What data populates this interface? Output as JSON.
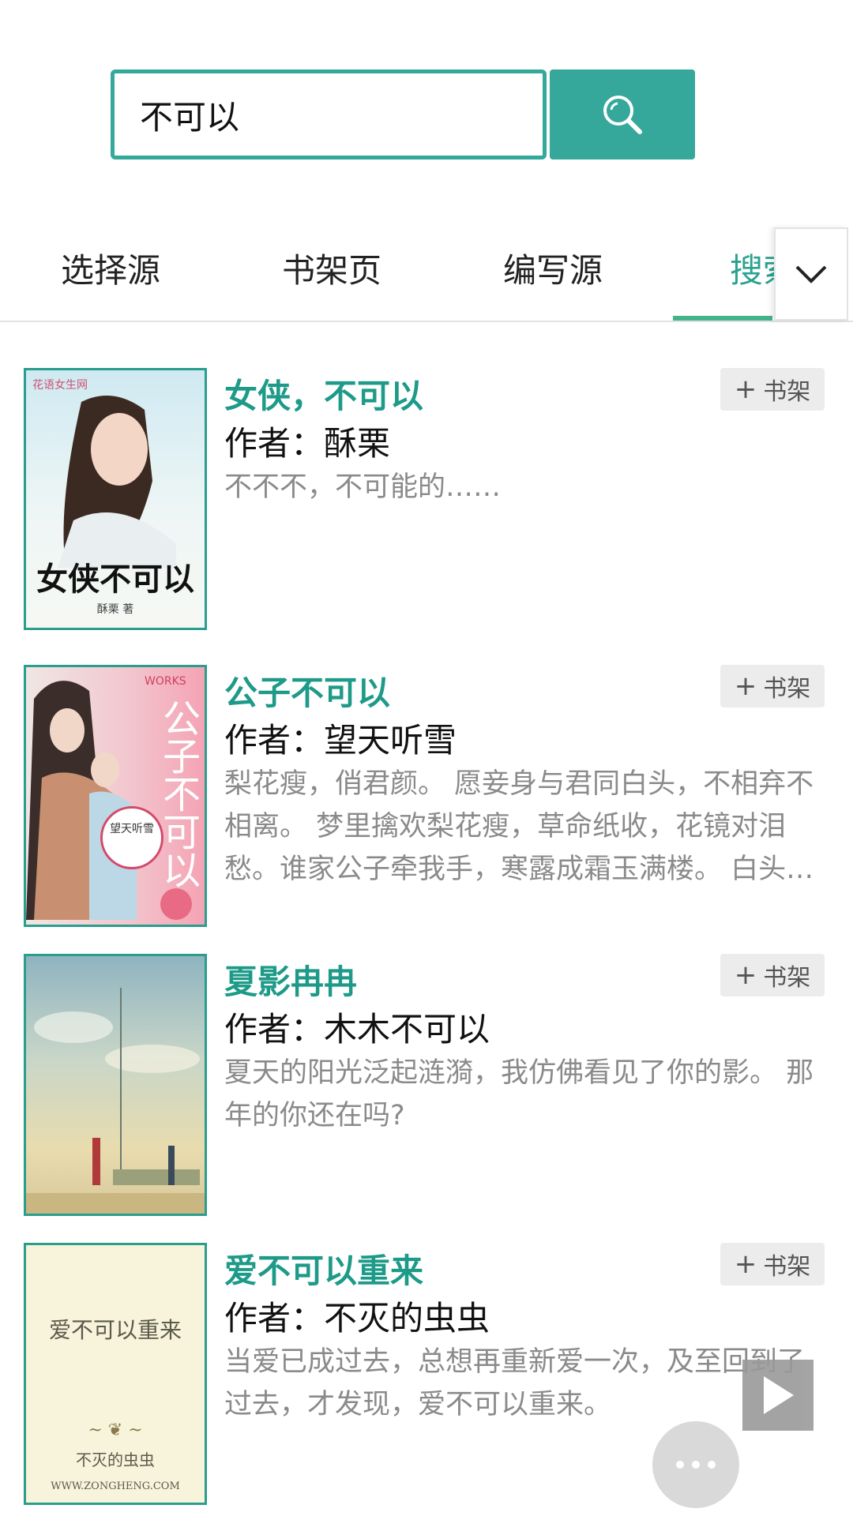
{
  "search": {
    "value": "不可以"
  },
  "tabs": [
    {
      "label": "选择源"
    },
    {
      "label": "书架页"
    },
    {
      "label": "编写源"
    },
    {
      "label": "搜索"
    }
  ],
  "shelf_label": "书架",
  "books": [
    {
      "title": "女侠，不可以",
      "author": "作者：酥栗",
      "desc": "不不不，不可能的……",
      "cover_text": "女侠不可以",
      "cover_sub": "酥栗 著",
      "cover_brand": "花语女生网"
    },
    {
      "title": "公子不可以",
      "author": "作者：望天听雪",
      "desc": "梨花瘦，俏君颜。 愿妾身与君同白头，不相弃不相离。 梦里擒欢梨花瘦，草命纸收，花镜对泪愁。谁家公子牵我手，寒露成霜玉满楼。 白头…",
      "cover_text": "公子不可以",
      "cover_sub": "望天听雪",
      "cover_brand": "WORKS"
    },
    {
      "title": "夏影冉冉",
      "author": "作者：木木不可以",
      "desc": "夏天的阳光泛起涟漪，我仿佛看见了你的影。 那年的你还在吗?",
      "cover_text": "",
      "cover_sub": "",
      "cover_brand": ""
    },
    {
      "title": "爱不可以重来",
      "author": "作者：不灭的虫虫",
      "desc": "当爱已成过去，总想再重新爱一次，及至回到了过去，才发现，爱不可以重来。",
      "cover_text": "爱不可以重来",
      "cover_sub": "不灭的虫虫",
      "cover_brand": "WWW.ZONGHENG.COM"
    }
  ],
  "colors": {
    "accent": "#35a89b",
    "title": "#1e9a89",
    "indicator": "#43b48a"
  }
}
